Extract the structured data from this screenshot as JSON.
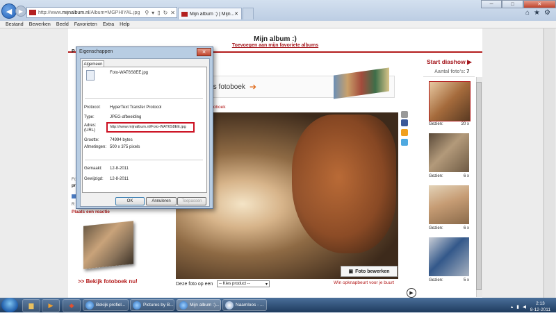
{
  "browser": {
    "address_prefix": "http://www.",
    "address_domain": "mijnalbum.nl",
    "address_rest": "/Album=MGPHIYAL.jpg",
    "tabs": [
      {
        "label": "Mijn album :) | Mijn..."
      }
    ],
    "window_controls": {
      "min": "─",
      "max": "□",
      "close": "✕"
    }
  },
  "menubar": [
    "Bestand",
    "Bewerken",
    "Beeld",
    "Favorieten",
    "Extra",
    "Help"
  ],
  "page": {
    "title": "Mijn album :)",
    "favorites_link": "Toevoegen aan mijn favoriete albums",
    "left_heading": "P",
    "left_stub": [
      "Fo",
      "pr",
      "R"
    ],
    "comment_link": "Plaats een reactie",
    "bekijk_link": ">> Bekijk fotoboek nu!",
    "banner_text": "als fotoboek",
    "breadcrumb": "toboek",
    "foto_bewerken": "Foto bewerken",
    "deze_foto": "Deze foto op een",
    "product_select": "-- Kies product --",
    "opknap_link": "Win opknapbeurt voor je buurt",
    "start_diashow": "Start diashow",
    "aantal_label": "Aantal foto's:",
    "aantal_value": "7",
    "thumbs": [
      {
        "label": "Gezien:",
        "count": "20 x"
      },
      {
        "label": "Gezien:",
        "count": "6 x"
      },
      {
        "label": "Gezien:",
        "count": "6 x"
      },
      {
        "label": "Gezien:",
        "count": "5 x"
      }
    ]
  },
  "dialog": {
    "title": "Eigenschappen",
    "tab": "Algemeen",
    "filename": "Foto-WAT6S8EE.jpg",
    "props": [
      {
        "label": "Protocol:",
        "value": "HyperText Transfer Protocol"
      },
      {
        "label": "Type:",
        "value": "JPEG-afbeelding"
      },
      {
        "label": "Adres:",
        "value": "http://www.mijnalbum.nl/Foto-WAT6S8EE.jpg"
      },
      {
        "label": "(URL)",
        "value": ""
      },
      {
        "label": "Grootte:",
        "value": "74994 bytes"
      },
      {
        "label": "Afmetingen:",
        "value": "500  x  375  pixels"
      },
      {
        "label": "Gemaakt:",
        "value": "12-8-2011"
      },
      {
        "label": "Gewijzigd:",
        "value": "12-8-2011"
      }
    ],
    "buttons": {
      "ok": "OK",
      "cancel": "Annuleren",
      "apply": "Toepassen"
    }
  },
  "taskbar": {
    "tasks": [
      "Bekijk profiel...",
      "Pictures by B...",
      "Mijn album :)...",
      "Naamloos - ..."
    ],
    "time": "2:13",
    "date": "8-12-2011"
  },
  "colors": {
    "accent": "#b31b1b",
    "brand_red": "#a3151b"
  }
}
